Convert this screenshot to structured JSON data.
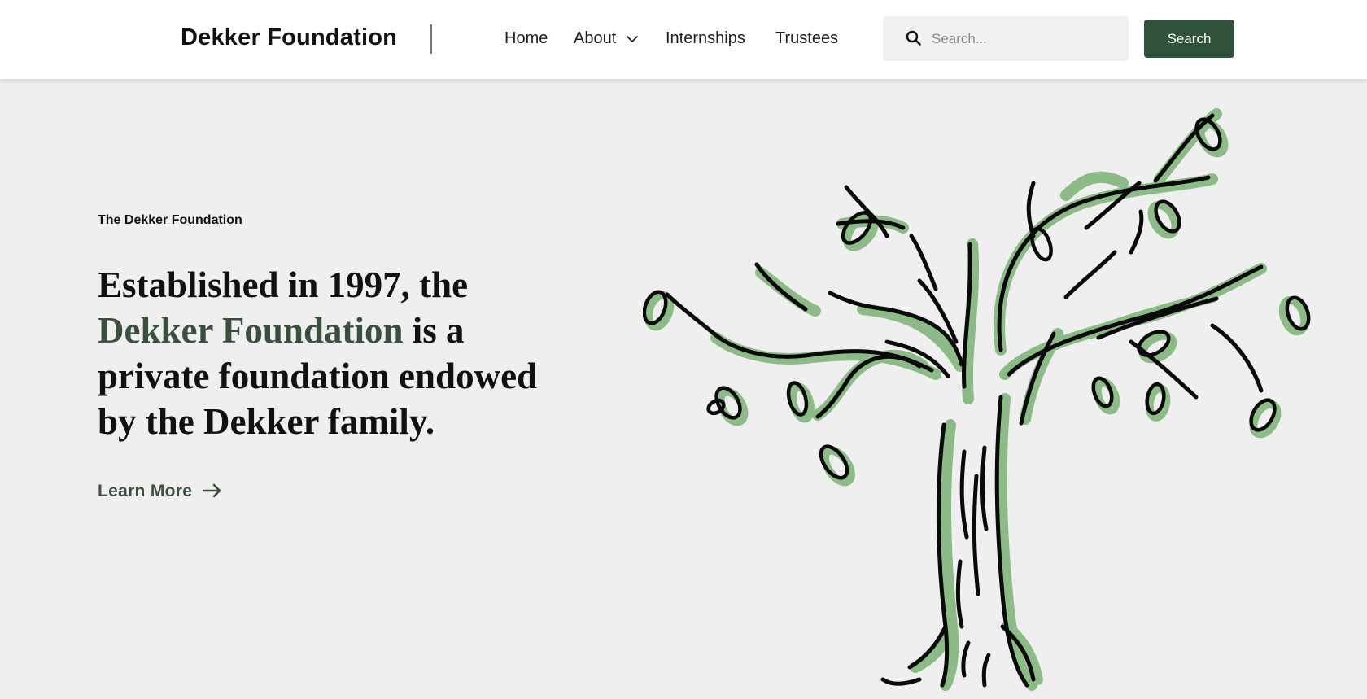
{
  "header": {
    "brand": "Dekker Foundation",
    "nav": [
      {
        "label": "Home"
      },
      {
        "label": "About",
        "has_dropdown": true
      },
      {
        "label": "Internships"
      },
      {
        "label": "Trustees"
      }
    ],
    "search": {
      "placeholder": "Search...",
      "value": "",
      "button_label": "Search"
    }
  },
  "hero": {
    "eyebrow": "The Dekker Foundation",
    "headline_before": "Established in 1997, the ",
    "headline_accent": "Dekker Foundation",
    "headline_after": " is a private foundation endowed by the Dekker family.",
    "cta_label": "Learn More",
    "illustration": "tree-illustration"
  },
  "colors": {
    "brand_green": "#31523a",
    "accent_text": "#3a4f3e",
    "leaf_green": "#8dbb88",
    "background": "#efefef",
    "header_bg": "#ffffff"
  },
  "icons": {
    "search": "search-icon",
    "dropdown": "chevron-down-icon",
    "cta_arrow": "arrow-right-icon"
  }
}
